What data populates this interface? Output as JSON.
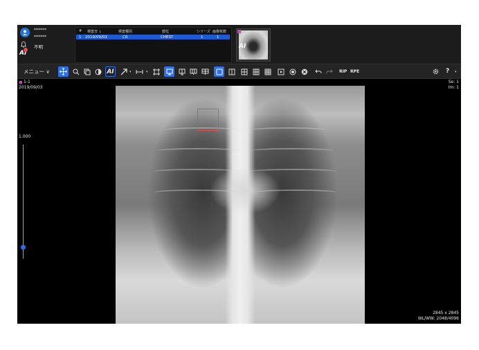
{
  "header": {
    "patient_name": "******",
    "patient_id": "******",
    "status": "不明",
    "ai_label": "AI"
  },
  "study_table": {
    "columns": [
      "#",
      "検査日 ↓",
      "検査種別",
      "部位",
      "シリーズ",
      "画像枚数"
    ],
    "rows": [
      {
        "index": "1",
        "date": "2019/09/03",
        "modality": "CR",
        "body_part": "CHEST",
        "series": "1",
        "images": "1"
      }
    ]
  },
  "thumbnail": {
    "ai_label": "AI"
  },
  "toolbar": {
    "menu_label": "メニュー ∨",
    "ai_label": "AI",
    "rip_label": "RIP",
    "rpe_label": "RPE",
    "help_label": "?",
    "tools": [
      "pan",
      "zoom",
      "copy",
      "window-level",
      "ai",
      "arrow",
      "measure",
      "crop",
      "layout-1x1",
      "layout-1x2",
      "layout-2x1",
      "layout-2x2",
      "fit",
      "grid-2",
      "grid-4",
      "grid-6",
      "grid-9",
      "cine",
      "invert",
      "reset",
      "undo",
      "redo",
      "settings"
    ],
    "active_color": "#2f6fe4"
  },
  "viewer": {
    "series_label": "1-1",
    "study_date": "2019/09/03",
    "series_num": "Se: 1",
    "image_num": "Im: 1",
    "zoom_value": "1.000",
    "dimensions": "2845 x 2845",
    "window_level": "WL/WW: 2048/4096",
    "roi_color": "#e05050"
  }
}
